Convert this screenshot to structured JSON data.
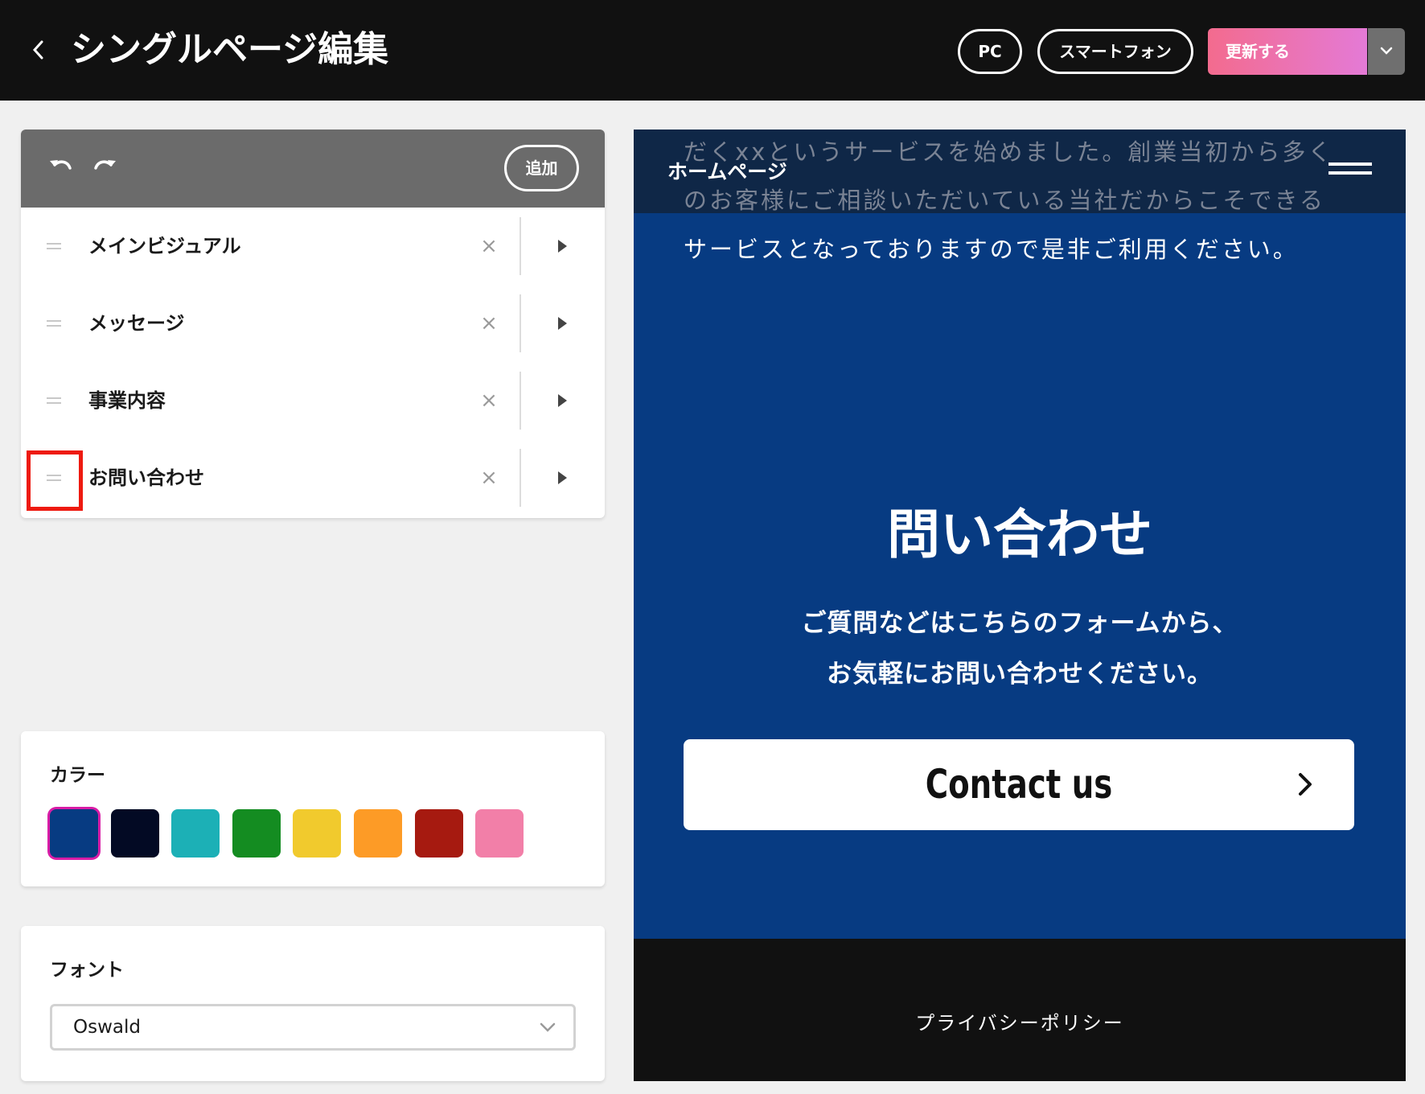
{
  "header": {
    "back_icon": "chevron-left-icon",
    "title": "シングルページ編集",
    "view_pc": "PC",
    "view_smartphone": "スマートフォン",
    "update_label": "更新する",
    "update_dropdown_icon": "chevron-down-icon"
  },
  "sections": {
    "undo_icon": "undo-icon",
    "redo_icon": "redo-icon",
    "add_label": "追加",
    "items": [
      {
        "label": "メインビジュアル",
        "delete": "×"
      },
      {
        "label": "メッセージ",
        "delete": "×"
      },
      {
        "label": "事業内容",
        "delete": "×"
      },
      {
        "label": "お問い合わせ",
        "delete": "×"
      }
    ]
  },
  "color": {
    "heading": "カラー",
    "swatches": [
      "#073b82",
      "#030a24",
      "#1cb0b6",
      "#148c21",
      "#f1ca2d",
      "#fd9b26",
      "#a61a10",
      "#f27fa8"
    ],
    "selected_index": 0,
    "selected_border": "#d81ca6"
  },
  "font": {
    "heading": "フォント",
    "value": "Oswald"
  },
  "preview": {
    "logo": "ホームページ",
    "body_lines": [
      "だくxxというサービスを始めました。創業当初から多く",
      "のお客様にご相談いただいている当社だからこそできる",
      "サービスとなっておりますので是非ご利用ください。"
    ],
    "contact_title": "問い合わせ",
    "contact_desc": [
      "ご質問などはこちらのフォームから、",
      "お気軽にお問い合わせください。"
    ],
    "contact_button": "Contact us",
    "footer_link": "プライバシーポリシー",
    "bg_color": "#073b82",
    "header_color": "#0f2747",
    "footer_color": "#111111"
  },
  "accent": {
    "update_gradient_start": "#f36b8e",
    "update_gradient_end": "#e47ad6",
    "highlight": "#ee1a10"
  }
}
